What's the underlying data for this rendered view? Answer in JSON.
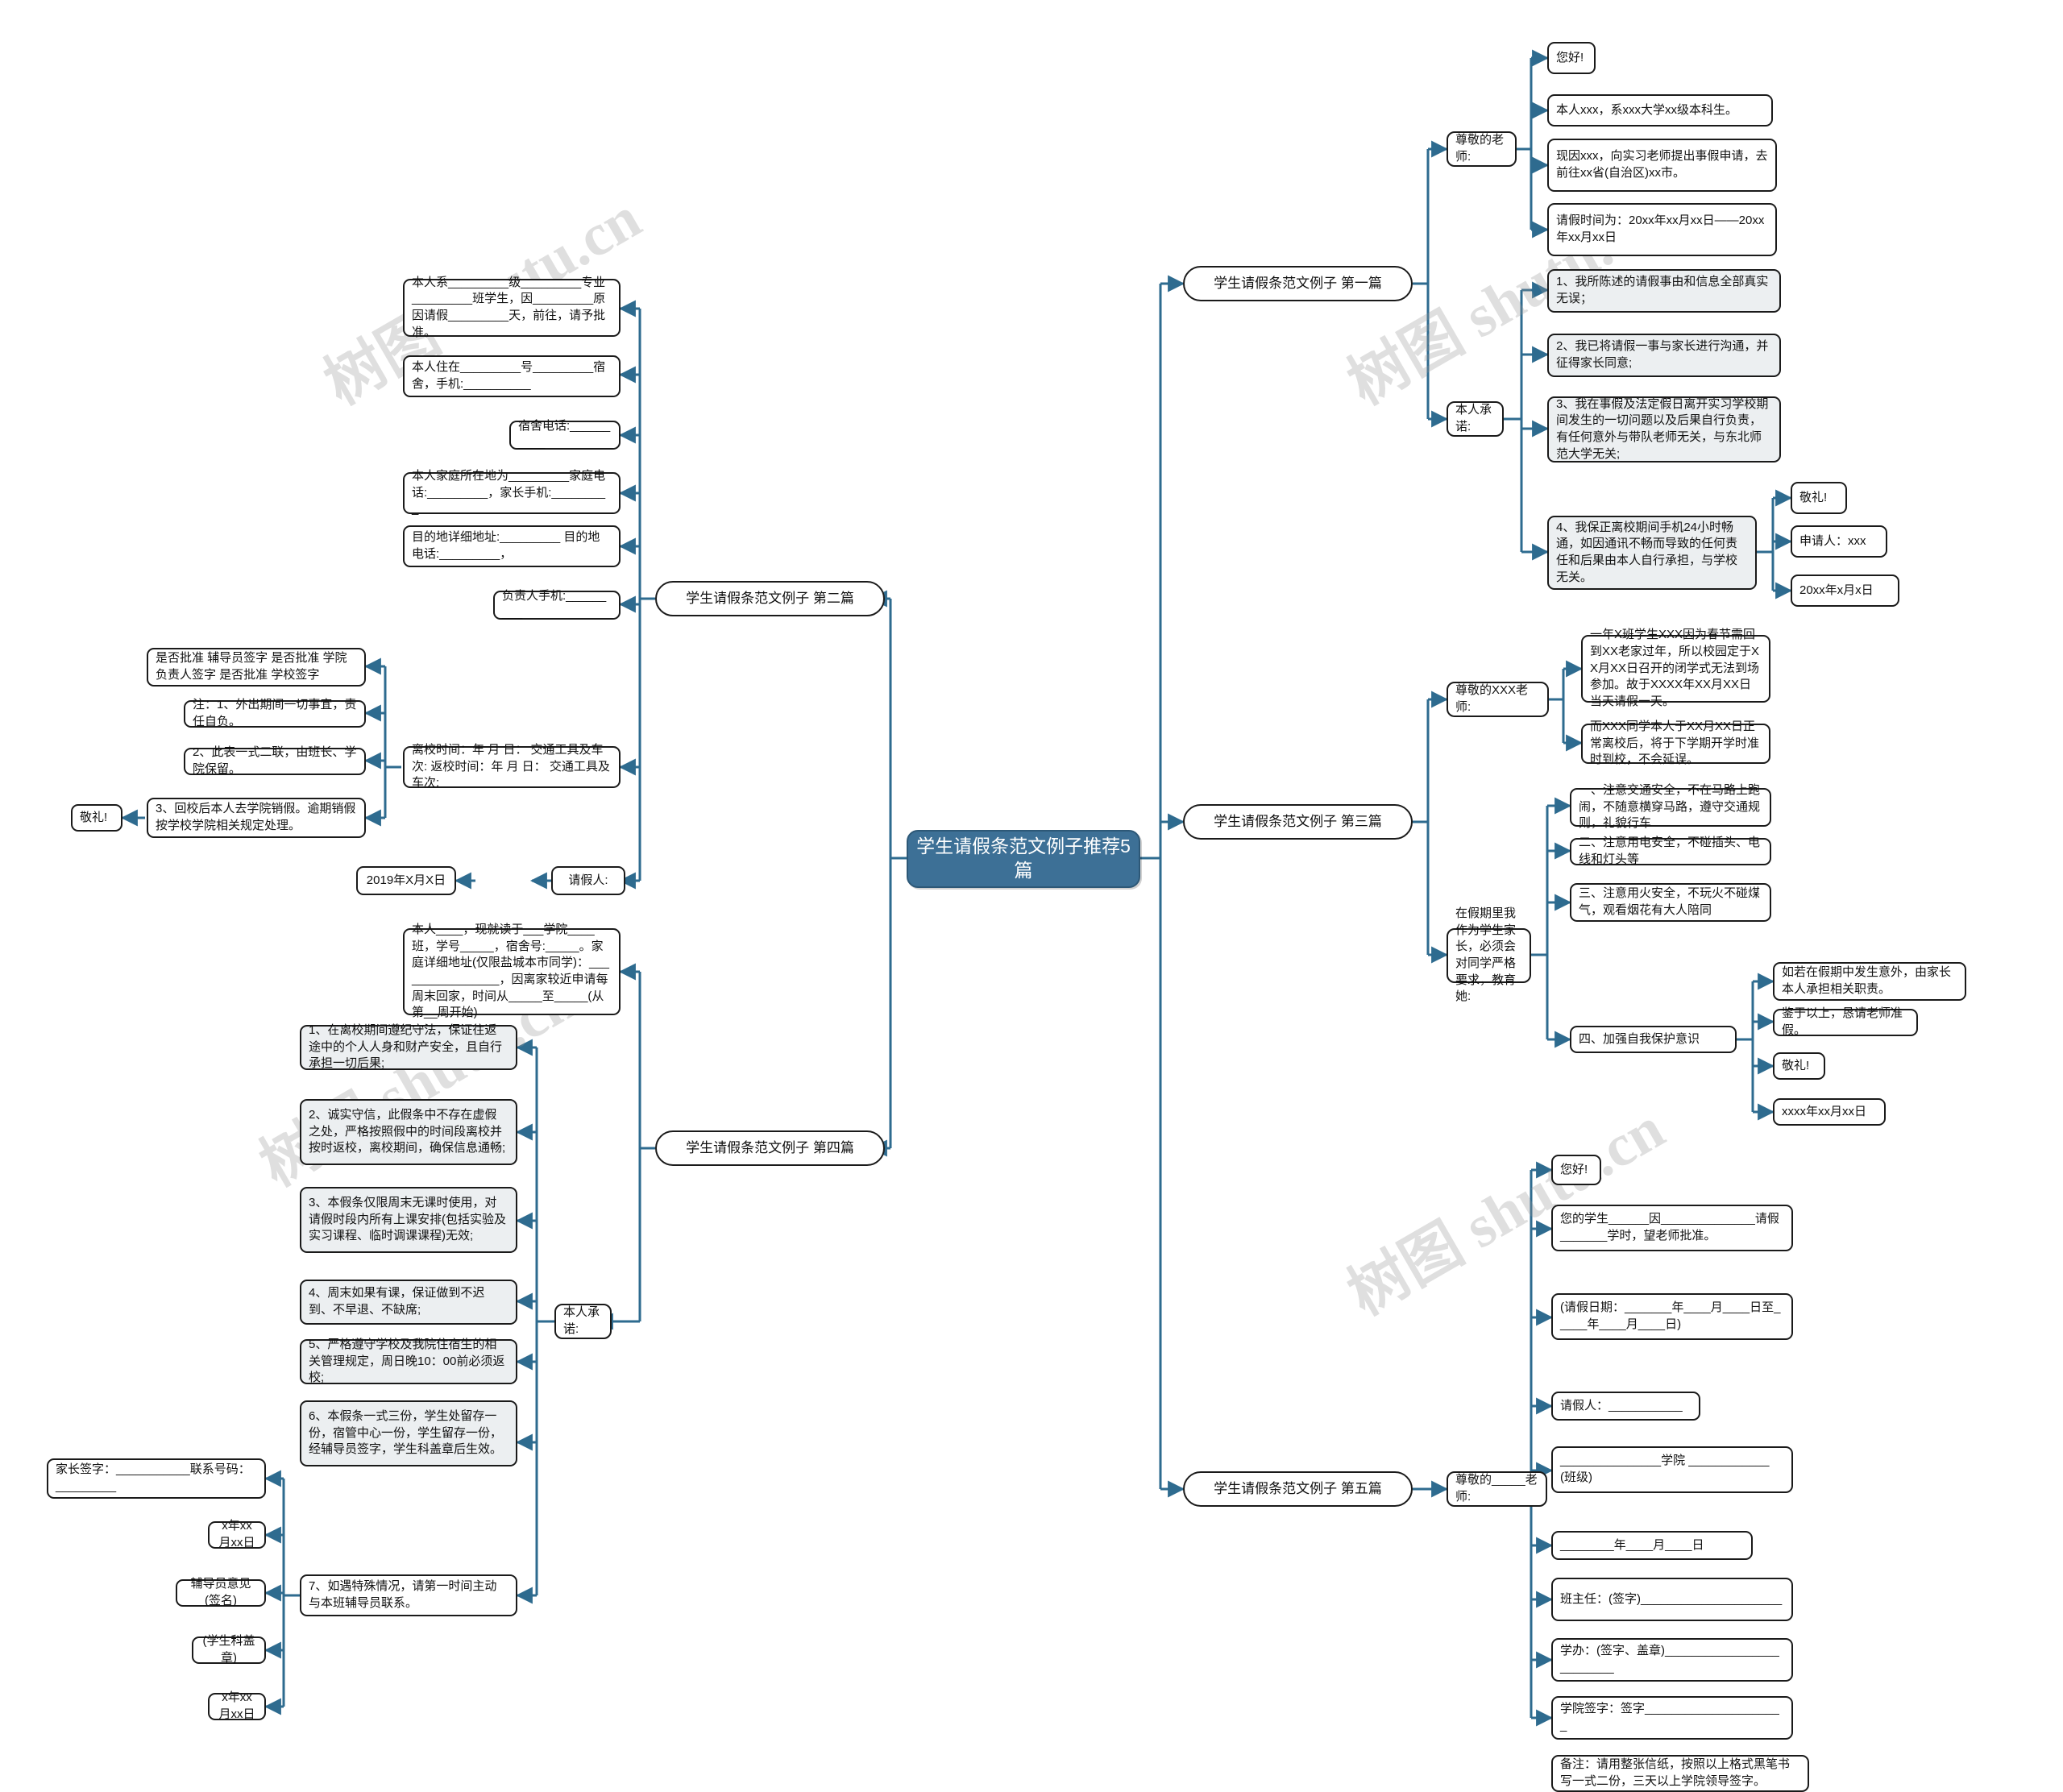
{
  "watermark_text": "树图 shutu.cn",
  "colors": {
    "center_fill": "#3d7096",
    "edge_line": "#2e6b8f",
    "node_border": "#1a1a1a",
    "shaded_fill": "#eceff1"
  },
  "center": {
    "title": "学生请假条范文例子推荐5篇"
  },
  "branches": {
    "b1": "学生请假条范文例子 第一篇",
    "b2": "学生请假条范文例子 第二篇",
    "b3": "学生请假条范文例子 第三篇",
    "b4": "学生请假条范文例子 第四篇",
    "b5": "学生请假条范文例子 第五篇"
  },
  "b1": {
    "teacher": "尊敬的老师:",
    "t1": "您好!",
    "t2": "本人xxx，系xxx大学xx级本科生。",
    "t3": "现因xxx，向实习老师提出事假申请，去前往xx省(自治区)xx市。",
    "t4": "请假时间为：20xx年xx月xx日——20xx年xx月xx日",
    "promise": "本人承诺:",
    "p1": "1、我所陈述的请假事由和信息全部真实无误；",
    "p2": "2、我已将请假一事与家长进行沟通，并征得家长同意;",
    "p3": "3、我在事假及法定假日离开实习学校期间发生的一切问题以及后果自行负责，有任何意外与带队老师无关，与东北师范大学无关;",
    "p4": "4、我保正离校期间手机24小时畅通，如因通讯不畅而导致的任何责任和后果由本人自行承担，与学校无关。",
    "s1": "敬礼!",
    "s2": "申请人：xxx",
    "s3": "20xx年x月x日"
  },
  "b2": {
    "n1": "本人系_________级_________专业_________班学生，因_________原因请假_________天，前往，请予批准。",
    "n2": "本人住在_________号_________宿舍，手机:__________",
    "n3": "宿舍电话:__________",
    "n4": "本人家庭所在地为_________家庭电话:_________，家长手机:_________",
    "n5": "目的地详细地址:_________ 目的地电话:_________，",
    "n6": "负责人手机:_________",
    "n7": "离校时间：年 月 日： 交通工具及车次: 返校时间：年 月 日： 交通工具及车次:",
    "n8": "是否批准 辅导员签字 是否批准 学院负责人签字 是否批准 学校签字",
    "n9": "注：1、外出期间一切事宜，责任自负。",
    "n10": "2、此表一式二联，由班长、学院保留。",
    "n11": "3、回校后本人去学院销假。逾期销假按学校学院相关规定处理。",
    "n12": "敬礼!",
    "n13": "请假人:",
    "n14": "2019年X月X日"
  },
  "b3": {
    "teacher": "尊敬的XXX老师:",
    "t1": "一年X班学生XXX因为春节需回到XX老家过年，所以校园定于XX月XX日召开的闭学式无法到场参加。故于XXXX年XX月XX日当天请假一天。",
    "t2": "而XXX同学本人于XX月XX日正常离校后，将于下学期开学时准时到校，不会延误。",
    "guardian": "在假期里我作为学生家长，必须会对同学严格要求，教育她:",
    "s1": "一、注意交通安全，不在马路上跑闹，不随意横穿马路，遵守交通规则，礼貌行车",
    "s2": "二、注意用电安全，不碰插头、电线和灯头等",
    "s3": "三、注意用火安全，不玩火不碰煤气，观看烟花有大人陪同",
    "s4": "四、加强自我保护意识",
    "e1": "如若在假期中发生意外，由家长本人承担相关职责。",
    "e2": "鉴于以上，恳请老师准假。",
    "e3": "敬礼!",
    "e4": "xxxx年xx月xx日"
  },
  "b4": {
    "n1": "本人____，现就读于___学院____班，学号_____，宿舍号:_____。家庭详细地址(仅限盐城本市同学)：________________，因离家较近申请每周末回家，时间从_____至_____(从第__周开始)",
    "promise": "本人承诺:",
    "p1": "1、在离校期间遵纪守法，保证往返途中的个人人身和财产安全，且自行承担一切后果;",
    "p2": "2、诚实守信，此假条中不存在虚假之处，严格按照假中的时间段离校并按时返校，离校期间，确保信息通畅;",
    "p3": "3、本假条仅限周末无课时使用，对请假时段内所有上课安排(包括实验及实习课程、临时调课课程)无效;",
    "p4": "4、周末如果有课，保证做到不迟到、不早退、不缺席;",
    "p5": "5、严格遵守学校及我院住宿生的相关管理规定，周日晚10：00前必须返校;",
    "p6": "6、本假条一式三份，学生处留存一份，宿管中心一份，学生留存一份，经辅导员签字，学生科盖章后生效。",
    "p7": "7、如遇特殊情况，请第一时间主动与本班辅导员联系。",
    "f1": "家长签字：___________联系号码：_________",
    "f2": "x年xx月xx日",
    "f3": "辅导员意见(签名)",
    "f4": "(学生科盖章)",
    "f5": "x年xx月xx日"
  },
  "b5": {
    "teacher": "尊敬的_____老师:",
    "n1": "您好!",
    "n2": "您的学生______因______________请假_______学时，望老师批准。",
    "n3": "(请假日期：_______年____月____日至_____年____月____日)",
    "n4": "请假人：___________",
    "n5": "_______________学院 ____________(班级)",
    "n6": "________年____月____日",
    "n7": "班主任：(签字)_____________________",
    "n8": "学办：(签字、盖章)_________________________",
    "n9": "学院签字：签字_____________________",
    "n10": "备注：请用整张信纸，按照以上格式黑笔书写一式二份，三天以上学院领导签字。"
  }
}
